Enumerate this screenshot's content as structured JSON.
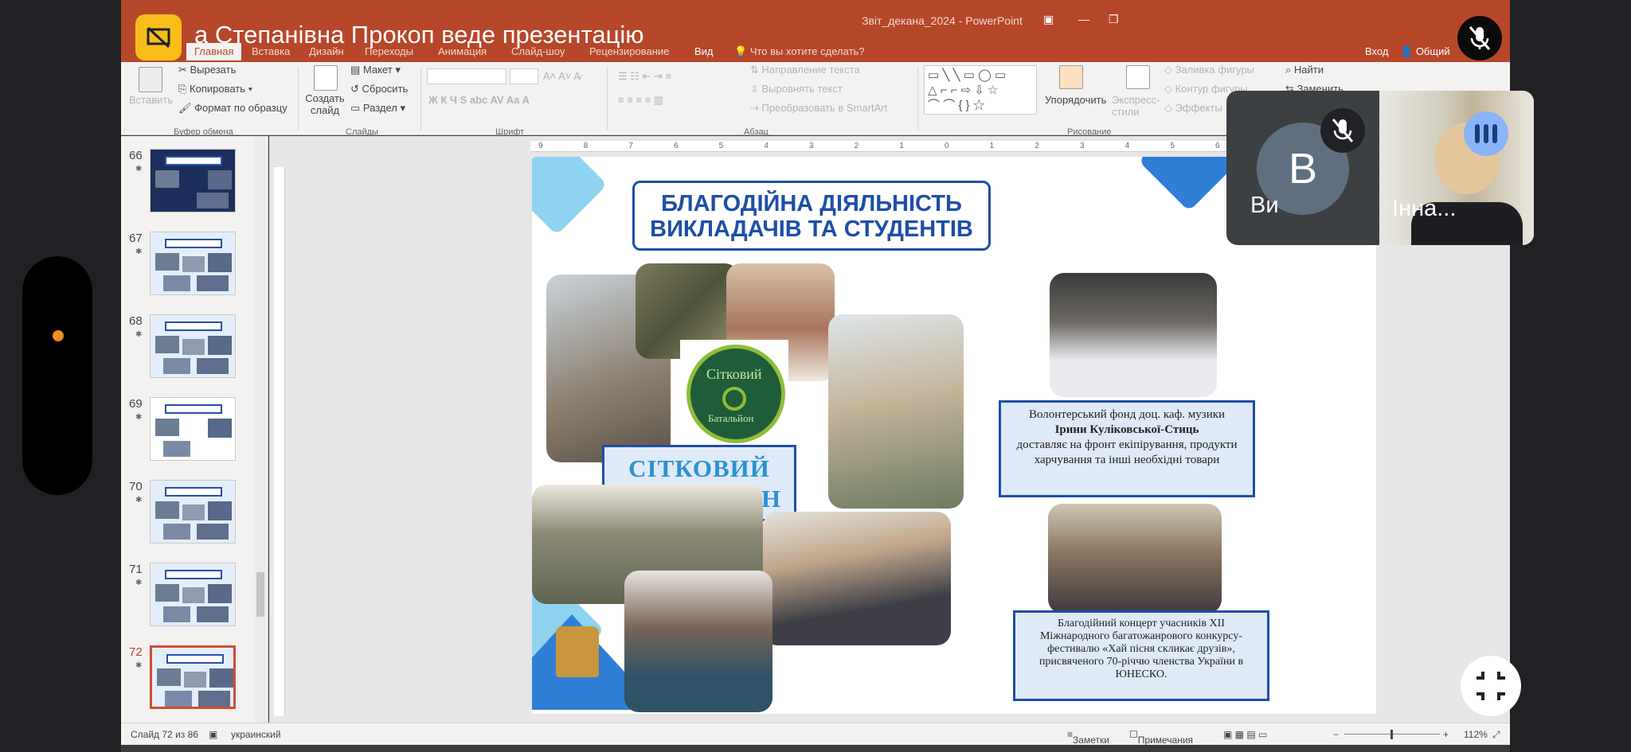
{
  "meet": {
    "presenter_text": "а Степанівна Прокоп веде презентацію",
    "participants": [
      {
        "initial": "B",
        "name": "Ви",
        "muted": true
      },
      {
        "name": "Інна...",
        "speaking": true
      }
    ],
    "icons": [
      "presentation-icon",
      "mic-off-icon",
      "exit-fullscreen-icon",
      "speaking-icon"
    ]
  },
  "powerpoint": {
    "document_title": "Звіт_декана_2024 - PowerPoint",
    "login": "Вход",
    "share": "Общий",
    "tabs": [
      "Главная",
      "Вставка",
      "Дизайн",
      "Переходы",
      "Анимация",
      "Слайд-шоу",
      "Рецензирование",
      "Вид"
    ],
    "tell_me": "Что вы хотите сделать?",
    "ribbon": {
      "paste": "Вставить",
      "cut": "Вырезать",
      "copy": "Копировать",
      "format_painter": "Формат по образцу",
      "new_slide": "Создать слайд",
      "layout": "Макет",
      "reset": "Сбросить",
      "section": "Раздел",
      "text_direction": "Направление текста",
      "align_text": "Выровнять текст",
      "smartart": "Преобразовать в SmartArt",
      "arrange": "Упорядочить",
      "quick_styles": "Экспресс-стили",
      "shape_fill": "Заливка фигуры",
      "shape_outline": "Контур фигуры",
      "shape_effects": "Эффекты",
      "find": "Найти",
      "replace": "Заменить",
      "groups": [
        "Буфер обмена",
        "Слайды",
        "Шрифт",
        "Абзац",
        "Рисование"
      ]
    },
    "thumbnails": [
      {
        "number": "66"
      },
      {
        "number": "67"
      },
      {
        "number": "68"
      },
      {
        "number": "69"
      },
      {
        "number": "70"
      },
      {
        "number": "71"
      },
      {
        "number": "72",
        "selected": true
      }
    ],
    "ruler_h": [
      "9",
      "8",
      "7",
      "6",
      "5",
      "4",
      "3",
      "2",
      "1",
      "0",
      "1",
      "2",
      "3",
      "4",
      "5",
      "6",
      "7",
      "8",
      "9"
    ],
    "slide": {
      "title_line1": "БЛАГОДІЙНА ДІЯЛЬНІСТЬ",
      "title_line2": "ВИКЛАДАЧІВ ТА СТУДЕНТІВ",
      "label_line1": "СІТКОВИЙ",
      "label_line2": "БАТАЛЬЙОН",
      "logo_text_top": "Сітковий",
      "logo_text_bottom": "Батальйон",
      "caption1_a": "Волонтерський фонд доц. каф. музики",
      "caption1_b": "Ірини Куліковської-Стиць",
      "caption1_c": "доставляє на фронт екіпірування, продукти харчування та інші необхідні товари",
      "caption2": "Благодійний концерт учасників XII Міжнародного багатожанрового конкурсу-фестивалю «Хай пісня скликає друзів», присвяченого 70-річчю членства України в ЮНЕСКО."
    },
    "status": {
      "slide_counter": "Слайд 72 из 86",
      "language": "украинский",
      "notes": "Заметки",
      "comments": "Примечания",
      "zoom": "112%"
    }
  }
}
